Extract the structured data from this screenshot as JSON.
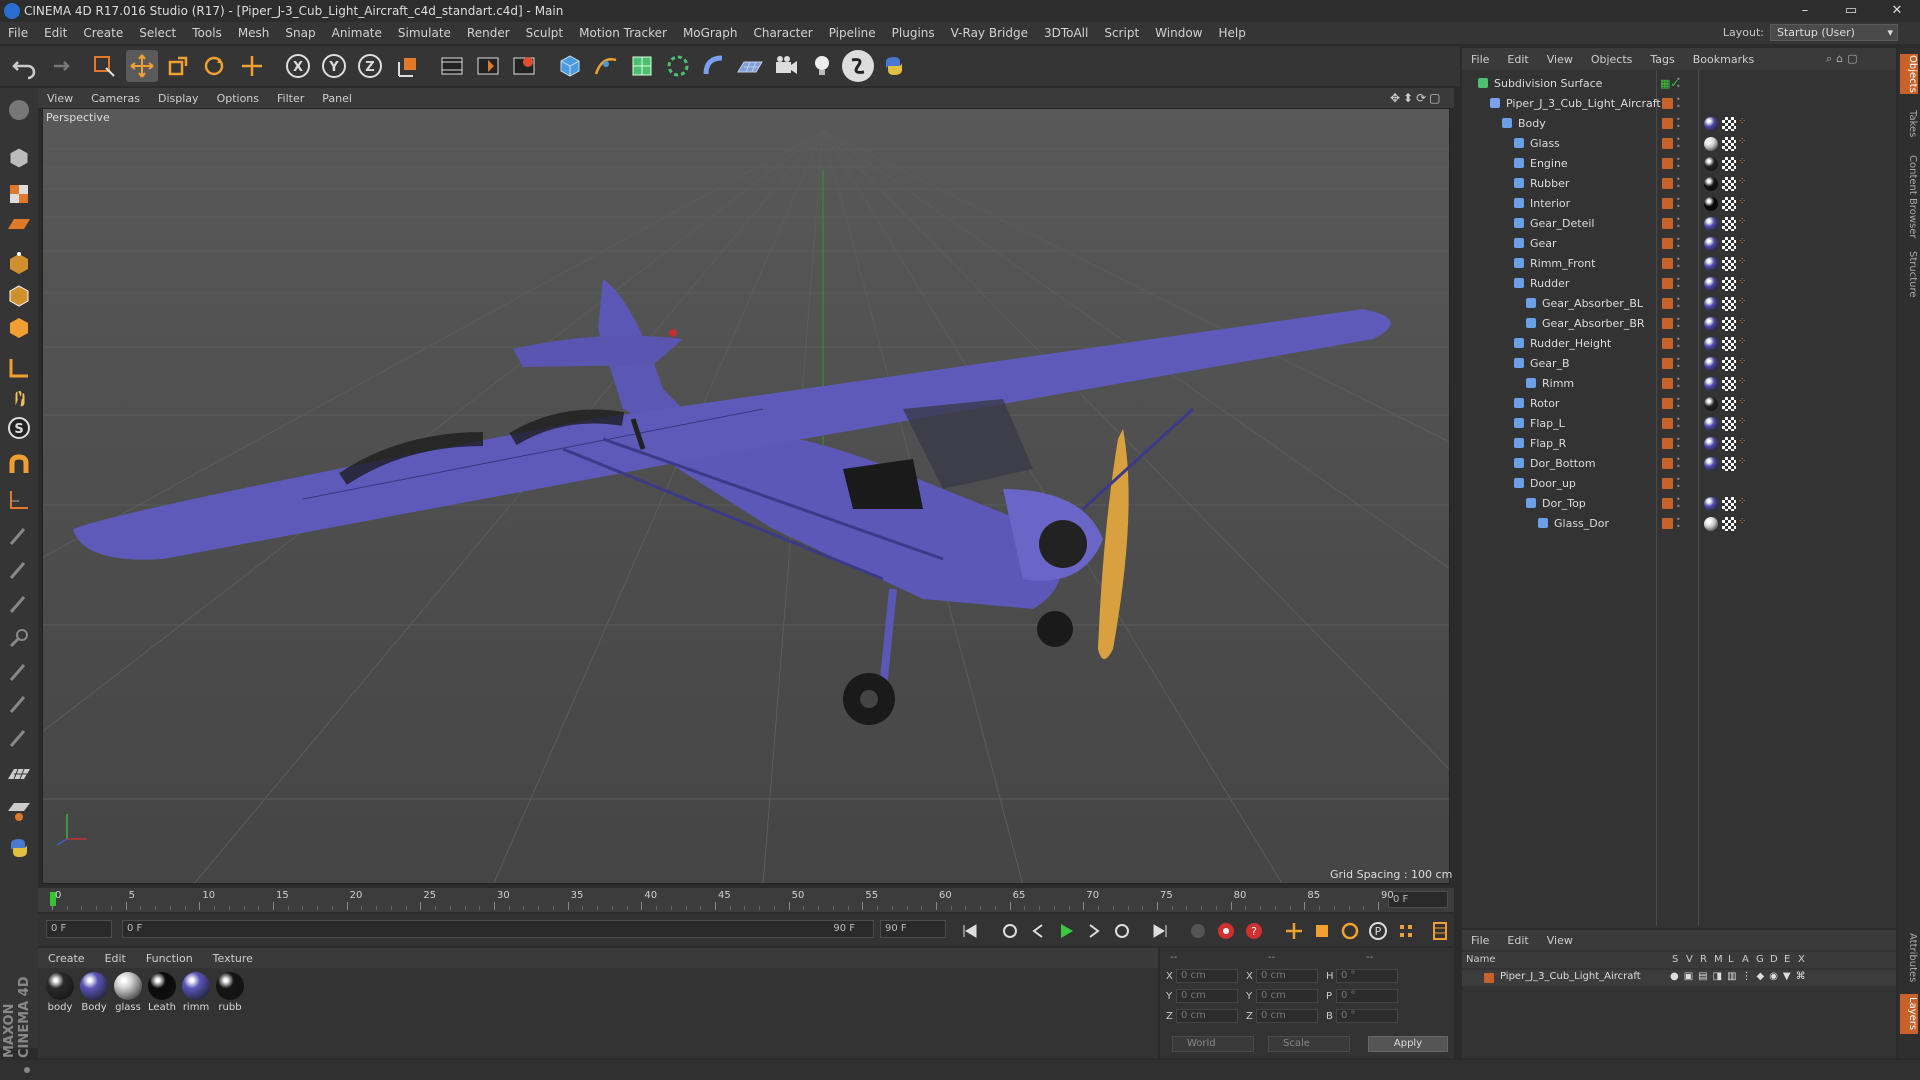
{
  "window": {
    "title": "CINEMA 4D R17.016 Studio (R17) - [Piper_J-3_Cub_Light_Aircraft_c4d_standart.c4d] - Main",
    "minimize": "–",
    "maximize": "▭",
    "close": "✕"
  },
  "menubar": [
    "File",
    "Edit",
    "Create",
    "Select",
    "Tools",
    "Mesh",
    "Snap",
    "Animate",
    "Simulate",
    "Render",
    "Sculpt",
    "Motion Tracker",
    "MoGraph",
    "Character",
    "Pipeline",
    "Plugins",
    "V-Ray Bridge",
    "3DToAll",
    "Script",
    "Window",
    "Help"
  ],
  "layout": {
    "label": "Layout:",
    "value": "Startup (User)"
  },
  "toolbar_icons": [
    "undo-icon",
    "redo-icon",
    "live-select-icon",
    "move-icon",
    "scale-icon",
    "rotate-icon",
    "transform-icon",
    "x-axis-icon",
    "y-axis-icon",
    "z-axis-icon",
    "world-coordinates-icon",
    "render-view-icon",
    "render-picture-viewer-icon",
    "edit-render-settings-icon",
    "cube-icon",
    "pen-spline-icon",
    "subdivision-surface-icon",
    "array-icon",
    "deformer-icon",
    "floor-icon",
    "camera-icon",
    "light-icon",
    "vray-icon",
    "python-icon"
  ],
  "axes": {
    "x": "X",
    "y": "Y",
    "z": "Z"
  },
  "viewport": {
    "menu": [
      "View",
      "Cameras",
      "Display",
      "Options",
      "Filter",
      "Panel"
    ],
    "label": "Perspective",
    "grid_spacing": "Grid Spacing : 100 cm"
  },
  "timeline": {
    "ticks": [
      "0",
      "5",
      "10",
      "15",
      "20",
      "25",
      "30",
      "35",
      "40",
      "45",
      "50",
      "55",
      "60",
      "65",
      "70",
      "75",
      "80",
      "85",
      "90"
    ],
    "current_frame": "0 F"
  },
  "transport": {
    "start": "0 F",
    "range_start": "0 F",
    "range_end": "90 F",
    "end": "90 F"
  },
  "material_manager": {
    "menu": [
      "Create",
      "Edit",
      "Function",
      "Texture"
    ],
    "materials": [
      {
        "name": "body",
        "color": "#2a2a2a"
      },
      {
        "name": "Body",
        "color": "#5a55b8"
      },
      {
        "name": "glass",
        "color": "#cfcfcf"
      },
      {
        "name": "Leath",
        "color": "#0a0a0a"
      },
      {
        "name": "rimm",
        "color": "#5a55b8"
      },
      {
        "name": "rubb",
        "color": "#151515"
      }
    ]
  },
  "coordinates": {
    "headers": [
      "--",
      "--",
      "--"
    ],
    "rows": [
      {
        "a": "X",
        "av": "0 cm",
        "b": "X",
        "bv": "0 cm",
        "c": "H",
        "cv": "0 °"
      },
      {
        "a": "Y",
        "av": "0 cm",
        "b": "Y",
        "bv": "0 cm",
        "c": "P",
        "cv": "0 °"
      },
      {
        "a": "Z",
        "av": "0 cm",
        "b": "Z",
        "bv": "0 cm",
        "c": "B",
        "cv": "0 °"
      }
    ],
    "mode": "World",
    "scale": "Scale",
    "apply": "Apply"
  },
  "object_manager": {
    "menu": [
      "File",
      "Edit",
      "View",
      "Objects",
      "Tags",
      "Bookmarks"
    ],
    "objects": [
      {
        "name": "Subdivision Surface",
        "level": 0,
        "tag": "none"
      },
      {
        "name": "Piper_J_3_Cub_Light_Aircraft",
        "level": 1,
        "tag": "none"
      },
      {
        "name": "Body",
        "level": 2,
        "tag": "body"
      },
      {
        "name": "Glass",
        "level": 3,
        "tag": "glass"
      },
      {
        "name": "Engine",
        "level": 3,
        "tag": "engine"
      },
      {
        "name": "Rubber",
        "level": 3,
        "tag": "rubber"
      },
      {
        "name": "Interior",
        "level": 3,
        "tag": "interior"
      },
      {
        "name": "Gear_Deteil",
        "level": 3,
        "tag": "body"
      },
      {
        "name": "Gear",
        "level": 3,
        "tag": "body"
      },
      {
        "name": "Rimm_Front",
        "level": 3,
        "tag": "body"
      },
      {
        "name": "Rudder",
        "level": 3,
        "tag": "body"
      },
      {
        "name": "Gear_Absorber_BL",
        "level": 4,
        "tag": "body"
      },
      {
        "name": "Gear_Absorber_BR",
        "level": 4,
        "tag": "body"
      },
      {
        "name": "Rudder_Height",
        "level": 3,
        "tag": "body"
      },
      {
        "name": "Gear_B",
        "level": 3,
        "tag": "body"
      },
      {
        "name": "Rimm",
        "level": 4,
        "tag": "body"
      },
      {
        "name": "Rotor",
        "level": 3,
        "tag": "engine"
      },
      {
        "name": "Flap_L",
        "level": 3,
        "tag": "body"
      },
      {
        "name": "Flap_R",
        "level": 3,
        "tag": "body"
      },
      {
        "name": "Dor_Bottom",
        "level": 3,
        "tag": "body"
      },
      {
        "name": "Door_up",
        "level": 3,
        "tag": "none"
      },
      {
        "name": "Dor_Top",
        "level": 4,
        "tag": "body"
      },
      {
        "name": "Glass_Dor",
        "level": 5,
        "tag": "glass"
      }
    ]
  },
  "layers": {
    "menu": [
      "File",
      "Edit",
      "View"
    ],
    "columns": [
      "Name",
      "S",
      "V",
      "R",
      "M",
      "L",
      "A",
      "G",
      "D",
      "E",
      "X"
    ],
    "row": "Piper_J_3_Cub_Light_Aircraft"
  },
  "side_tabs": [
    "Objects",
    "Takes",
    "Content Browser",
    "Structure"
  ],
  "side_tabs_bottom": [
    "Attributes",
    "Layers"
  ],
  "brand": "MAXON CINEMA 4D"
}
